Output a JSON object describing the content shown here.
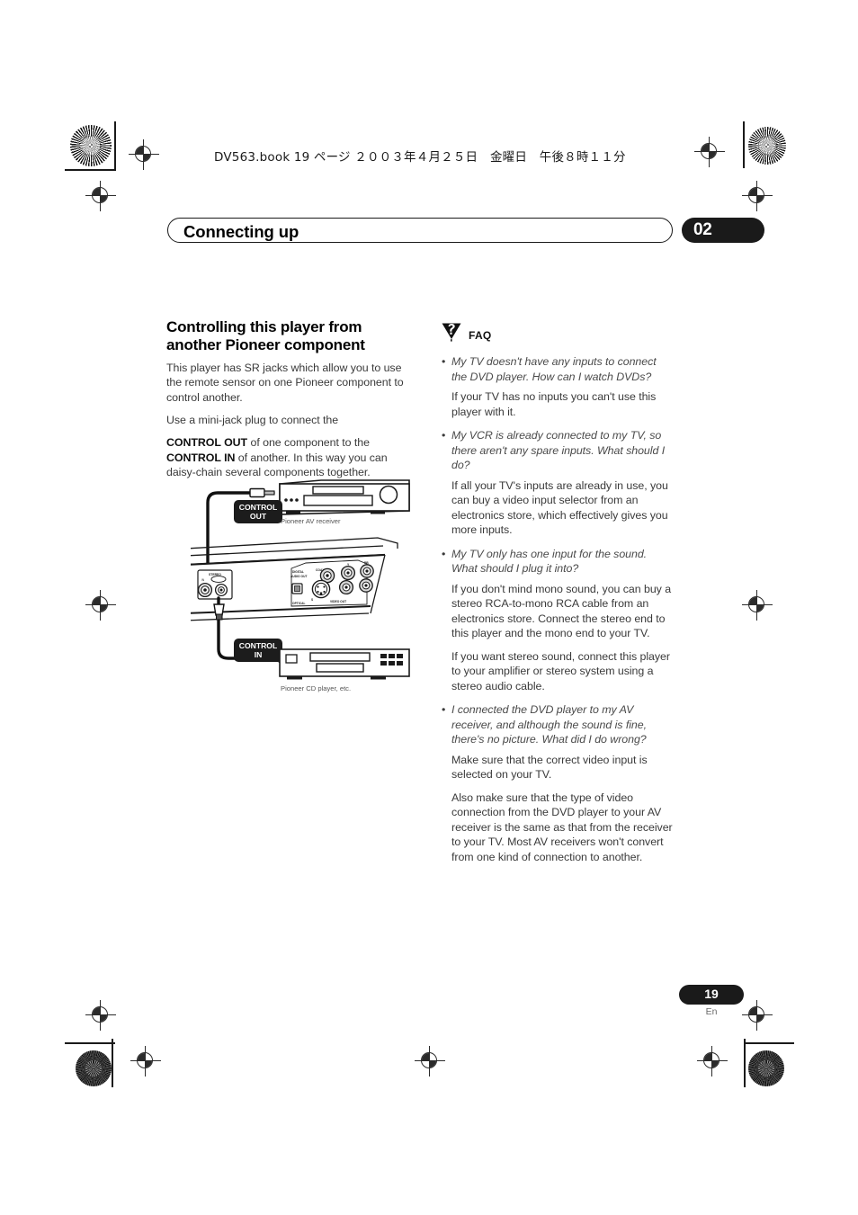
{
  "page": {
    "header_info": "DV563.book  19 ページ  ２００３年４月２５日　金曜日　午後８時１１分",
    "running_head": "Connecting up",
    "chapter_number": "02",
    "page_number": "19",
    "language_code": "En",
    "accent_color": "#1a1a1a",
    "body_color": "#3a3a3a"
  },
  "left_column": {
    "section_title": "Controlling this player from another Pioneer component",
    "paragraph_1": "This player has SR jacks which allow you to use the remote sensor on one Pioneer component to control another.",
    "paragraph_2_lead": "Use a mini-jack plug to connect the",
    "paragraph_2_parts": {
      "bold_1": "CONTROL OUT",
      "mid_1": " of one component to the ",
      "bold_2": "CONTROL IN",
      "tail": " of another. In this way you can daisy-chain several components together."
    }
  },
  "diagram": {
    "label_control_out_line1": "CONTROL",
    "label_control_out_line2": "OUT",
    "label_control_in_line1": "CONTROL",
    "label_control_in_line2": "IN",
    "caption_top": "Pioneer AV receiver",
    "caption_bottom": "Pioneer CD player, etc.",
    "rear_panel_labels": {
      "digital_audio_out": "DIGITAL AUDIO OUT",
      "coaxial": "COAXIAL",
      "optical": "OPTICAL",
      "video_out": "VIDEO OUT",
      "s_video": "S",
      "component_y": "Y",
      "component_pb": "PB"
    }
  },
  "faq": {
    "label": "FAQ",
    "icon": "faq-triangle-question-icon",
    "items": [
      {
        "question": "My TV doesn't have any inputs to connect the DVD player. How can I watch DVDs?",
        "answers": [
          "If your TV has no inputs you can't use this player with it."
        ]
      },
      {
        "question": "My VCR is already connected to my TV, so there aren't any spare inputs. What should I do?",
        "answers": [
          "If all your TV's inputs are already in use, you can buy a video input selector from an electronics store, which effectively gives you more inputs."
        ]
      },
      {
        "question": "My TV only has one input for the sound. What should I plug it into?",
        "answers": [
          "If you don't mind mono sound, you can buy a stereo RCA-to-mono RCA cable from an electronics store. Connect the stereo end to this player and the mono end to your TV.",
          "If you want stereo sound, connect this player to your amplifier or stereo system using a stereo audio cable."
        ]
      },
      {
        "question": "I connected the DVD player to my AV receiver, and although the sound is fine, there's no picture. What did I do wrong?",
        "answers": [
          "Make sure that the correct video input is selected on your TV.",
          "Also make sure that the type of video connection from the DVD player to your AV receiver is the same as that from the receiver to your TV. Most AV receivers won't convert from one kind of connection to another."
        ]
      }
    ]
  }
}
